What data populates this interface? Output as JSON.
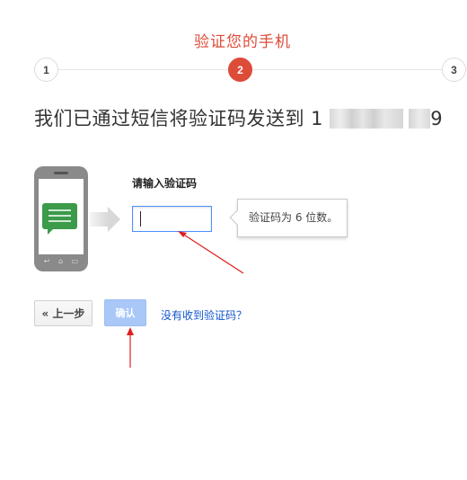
{
  "header": {
    "title": "验证您的手机"
  },
  "progress": {
    "steps": [
      "1",
      "2",
      "3"
    ],
    "current": 2,
    "accent": "#dd4b39"
  },
  "main": {
    "headline": "我们已通过短信将验证码发送到 1",
    "headline_tail": "9",
    "input_label": "请输入验证码",
    "input_value": "",
    "tooltip": "验证码为 6 位数。"
  },
  "actions": {
    "back_label": "« 上一步",
    "confirm_label": "确认",
    "resend_link": "没有收到验证码？",
    "link_color": "#1155cc"
  },
  "icons": [
    "phone-icon",
    "sms-icon",
    "arrow-right-icon"
  ]
}
